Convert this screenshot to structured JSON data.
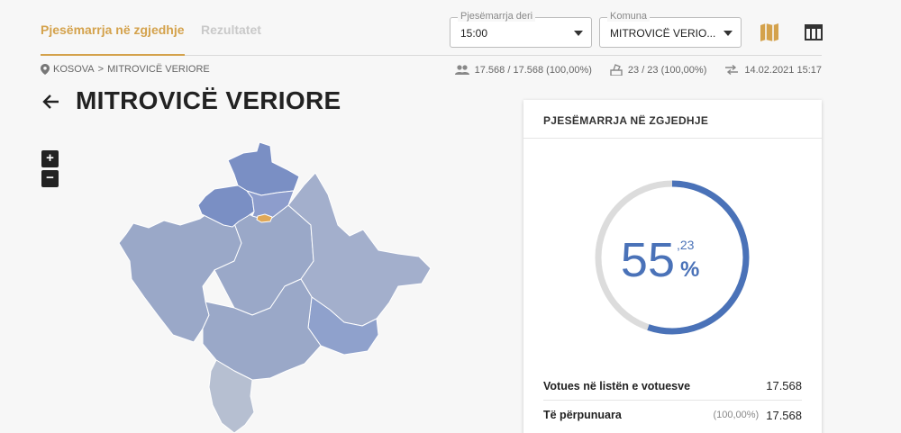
{
  "tabs": {
    "active": "Pjesëmarrja në zgjedhje",
    "inactive": "Rezultatet"
  },
  "filters": {
    "time": {
      "label": "Pjesëmarrja deri",
      "value": "15:00"
    },
    "komuna": {
      "label": "Komuna",
      "value": "MITROVICË VERIO..."
    }
  },
  "icons": {
    "map": "map-icon",
    "table": "table-icon"
  },
  "breadcrumb": {
    "root": "KOSOVA",
    "current": "MITROVICË VERIORE"
  },
  "stats": {
    "voters": "17.568 / 17.568 (100,00%)",
    "stations": "23 / 23 (100,00%)",
    "updated": "14.02.2021 15:17"
  },
  "page": {
    "title": "MITROVICË VERIORE"
  },
  "zoom": {
    "in": "+",
    "out": "−"
  },
  "turnout": {
    "header": "PJESËMARRJA NË ZGJEDHJE",
    "percent_int": "55",
    "percent_dec": ",23",
    "percent_sign": "%",
    "value": 55.23,
    "rows": [
      {
        "label": "Votues në listën e votuesve",
        "pct": "",
        "value": "17.568"
      },
      {
        "label": "Të përpunuara",
        "pct": "(100,00%)",
        "value": "17.568"
      }
    ]
  },
  "colors": {
    "accent": "#d4a24c",
    "gauge": "#4a72b8",
    "gauge_track": "#dcdcdc",
    "map_base": "#9aa8c8",
    "map_dark": "#7a8fc4",
    "map_light": "#b6bfd1",
    "map_highlight": "#e0a857"
  }
}
